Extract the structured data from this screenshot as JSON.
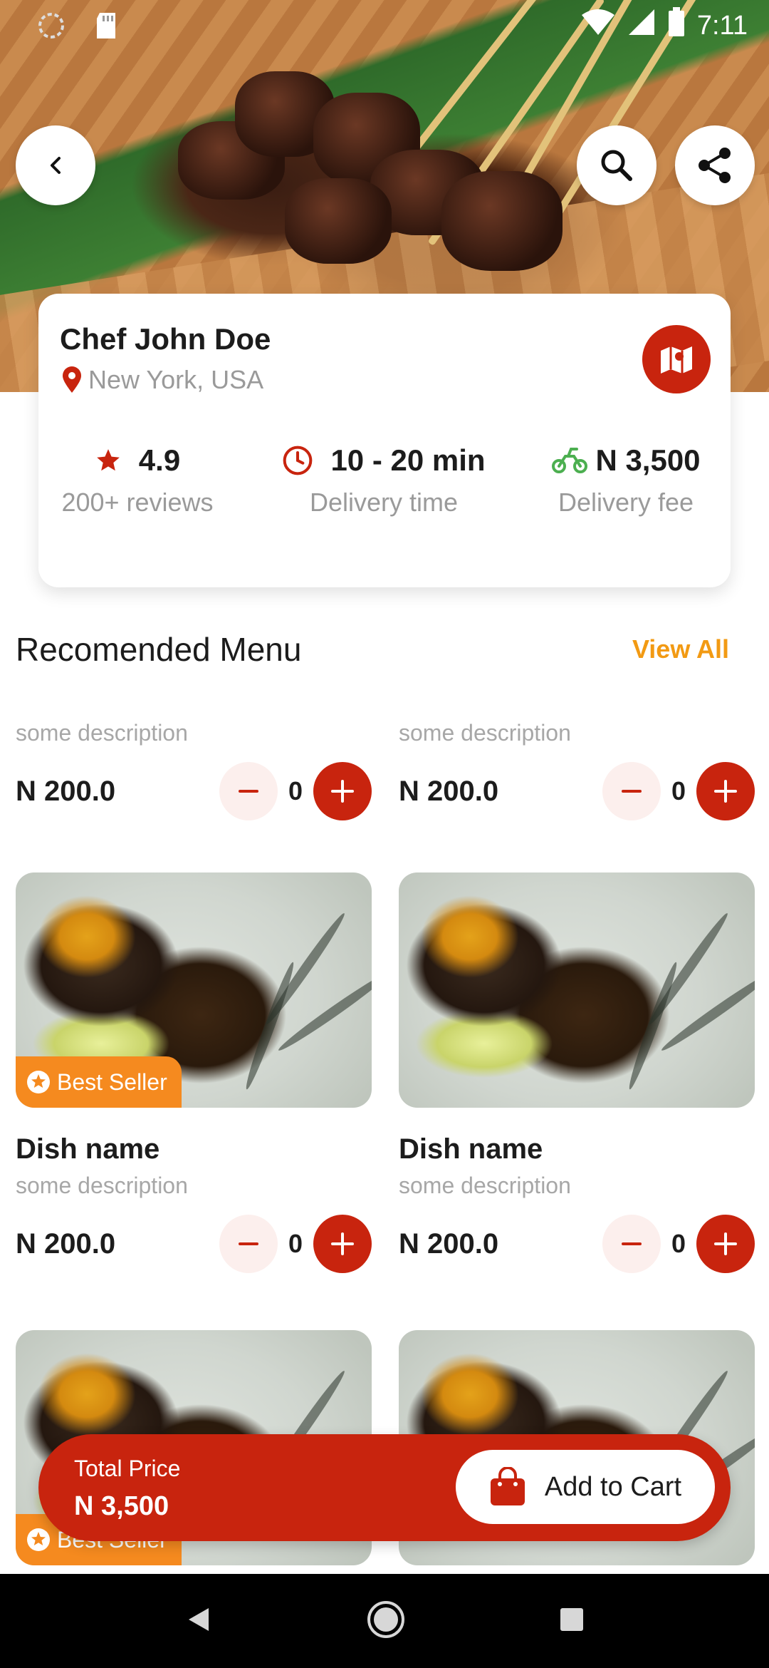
{
  "status_bar": {
    "time": "7:11"
  },
  "chef": {
    "name": "Chef John Doe",
    "location": "New York, USA"
  },
  "stats": [
    {
      "value": "4.9",
      "label": "200+ reviews",
      "icon": "star-icon",
      "color": "#c8240e"
    },
    {
      "value": "10 - 20 min",
      "label": "Delivery time",
      "icon": "clock-icon",
      "color": "#c8240e"
    },
    {
      "value": "N 3,500",
      "label": "Delivery fee",
      "icon": "motorbike-icon",
      "color": "#4caf50"
    }
  ],
  "section": {
    "title": "Recomended Menu",
    "view_all": "View All"
  },
  "partial_cards": [
    {
      "description": "some description",
      "price": "N 200.0",
      "qty": "0"
    },
    {
      "description": "some description",
      "price": "N 200.0",
      "qty": "0"
    }
  ],
  "cards": [
    {
      "badge": "Best Seller",
      "name": "Dish name",
      "description": "some description",
      "price": "N 200.0",
      "qty": "0"
    },
    {
      "badge": "",
      "name": "Dish name",
      "description": "some description",
      "price": "N 200.0",
      "qty": "0"
    }
  ],
  "bottom_cards": [
    {
      "badge": "Best Seller"
    },
    {
      "badge": ""
    }
  ],
  "cart": {
    "total_label": "Total Price",
    "total_value": "N 3,500",
    "button_label": "Add to Cart"
  },
  "colors": {
    "primary": "#c8240e",
    "accent": "#f29a13",
    "badge": "#f58a1f"
  }
}
